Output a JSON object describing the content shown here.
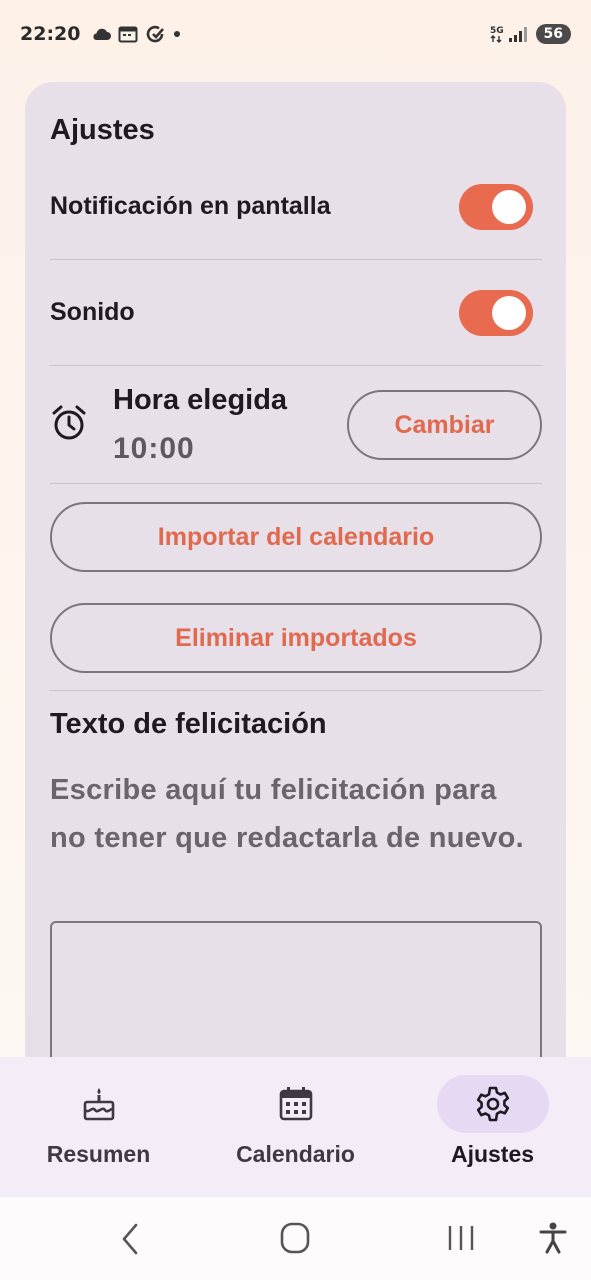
{
  "status_bar": {
    "time": "22:20",
    "battery": "56"
  },
  "settings": {
    "title": "Ajustes",
    "screen_notification": {
      "label": "Notificación en pantalla",
      "enabled": true
    },
    "sound": {
      "label": "Sonido",
      "enabled": true
    },
    "chosen_time": {
      "label": "Hora elegida",
      "value": "10:00",
      "change_label": "Cambiar"
    },
    "import_calendar_label": "Importar del calendario",
    "delete_imported_label": "Eliminar importados",
    "greeting": {
      "title": "Texto de felicitación",
      "helper": "Escribe aquí tu felicitación para no tener que redactarla de nuevo.",
      "value": ""
    }
  },
  "bottom_nav": {
    "items": [
      {
        "label": "Resumen",
        "icon": "cake-icon"
      },
      {
        "label": "Calendario",
        "icon": "calendar-icon"
      },
      {
        "label": "Ajustes",
        "icon": "gear-icon",
        "active": true
      }
    ]
  },
  "colors": {
    "accent": "#e86a4f",
    "card": "#e7e0e8",
    "nav_bg": "#f4ecf6",
    "nav_active_pill": "#e5d9f4"
  }
}
